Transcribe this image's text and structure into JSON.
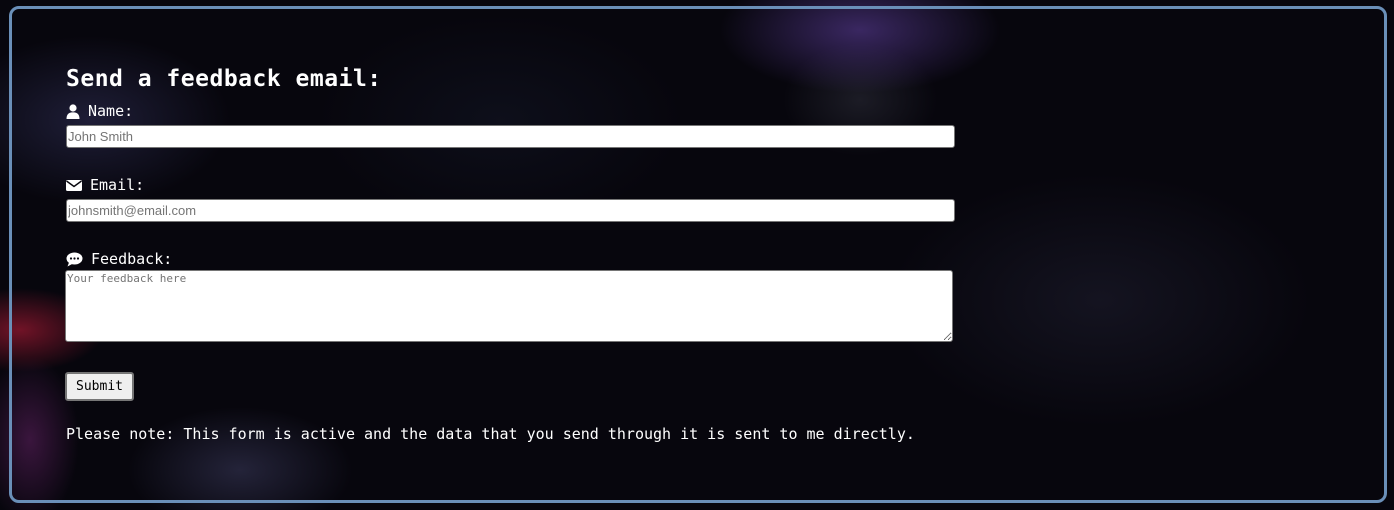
{
  "form": {
    "heading": "Send a feedback email:",
    "name": {
      "label": "Name:",
      "placeholder": "John Smith",
      "icon": "user-icon"
    },
    "email": {
      "label": "Email:",
      "placeholder": "johnsmith@email.com",
      "icon": "envelope-icon"
    },
    "feedback": {
      "label": "Feedback:",
      "placeholder": "Your feedback here",
      "icon": "comment-icon"
    },
    "submit_label": "Submit",
    "note": "Please note: This form is active and the data that you send through it is sent to me directly."
  },
  "colors": {
    "frame_border": "#6a8fb8",
    "text": "#ffffff",
    "background": "#07060d"
  }
}
